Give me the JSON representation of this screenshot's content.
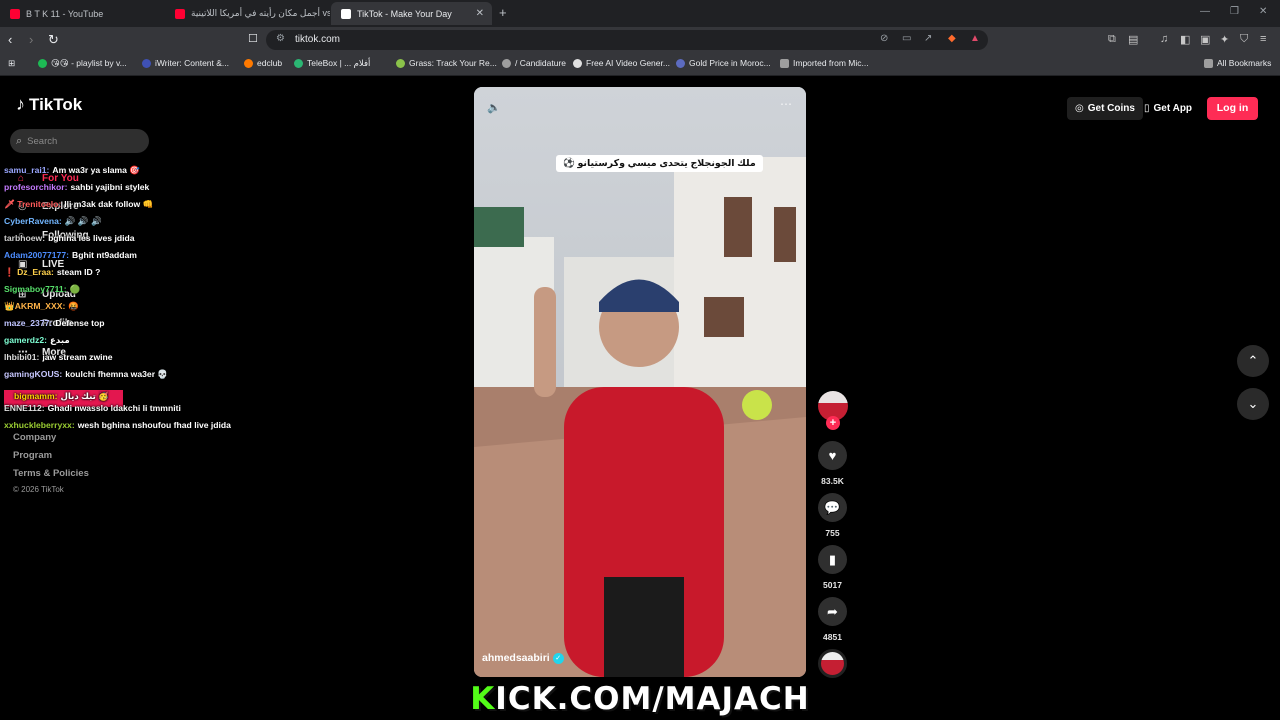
{
  "browser": {
    "tabs": [
      {
        "title": "B T K 11 - YouTube",
        "fav_color": "#ff0033"
      },
      {
        "title": "أجمل مكان رأيته في أمريكا اللاتينية vs ...",
        "fav_color": "#ff0033"
      },
      {
        "title": "TikTok - Make Your Day",
        "fav_color": "#ffffff"
      }
    ],
    "url": "tiktok.com",
    "bookmarks": [
      {
        "label": "😘😘 - playlist by v...",
        "color": "#1db954"
      },
      {
        "label": "iWriter: Content &...",
        "color": "#3f51b5"
      },
      {
        "label": "edclub",
        "color": "#ff7a00"
      },
      {
        "label": "TeleBox | ... أفلام",
        "color": "#2bb673"
      },
      {
        "label": "Grass: Track Your Re...",
        "color": "#8bc34a"
      },
      {
        "label": "/ Candidature",
        "color": "#9e9e9e"
      },
      {
        "label": "Free AI Video Gener...",
        "color": "#e0e0e0"
      },
      {
        "label": "Gold Price in Moroc...",
        "color": "#5c6bc0"
      },
      {
        "label": "Imported from Mic...",
        "color": "#9e9e9e"
      }
    ],
    "all_bookmarks": "All Bookmarks"
  },
  "sidebar": {
    "logo": "TikTok",
    "search_placeholder": "Search",
    "nav": [
      {
        "label": "For You",
        "icon": "home-icon"
      },
      {
        "label": "Explore",
        "icon": "compass-icon"
      },
      {
        "label": "Following",
        "icon": "person-icon"
      },
      {
        "label": "LIVE",
        "icon": "live-icon"
      },
      {
        "label": "Upload",
        "icon": "upload-icon"
      },
      {
        "label": "Profile",
        "icon": "profile-icon"
      },
      {
        "label": "More",
        "icon": "more-icon"
      }
    ],
    "footer": [
      "Company",
      "Program",
      "Terms & Policies"
    ],
    "copyright": "© 2026 TikTok"
  },
  "chat": [
    {
      "user": "samu_rai1:",
      "text": "Am wa3r ya slama 🎯",
      "color": "#9aa7ff"
    },
    {
      "user": "profesorchikor:",
      "text": "sahbi yajibni stylek",
      "color": "#c57bff"
    },
    {
      "user": "🗡 Trenitoelo:",
      "text": "lli m3ak dak follow 👊",
      "color": "#ff5a5a"
    },
    {
      "user": "CyberRavena:",
      "text": "🔊 🔊 🔊",
      "color": "#72b6ff"
    },
    {
      "user": "tarbhoew:",
      "text": "bghina les lives jdida",
      "color": "#cfcfcf"
    },
    {
      "user": "Adam20077177:",
      "text": "Bghit nt9addam",
      "color": "#4d8dff"
    },
    {
      "user": "❗ Dz_Eraa:",
      "text": "steam ID ?",
      "color": "#ffd24d"
    },
    {
      "user": "Sigmaboy7711:",
      "text": "🟢",
      "color": "#58e06b"
    },
    {
      "user": "👑AKRM_XXX:",
      "text": "🤬",
      "color": "#ffb347"
    },
    {
      "user": "maze_2377:",
      "text": "Defense top",
      "color": "#bfc4ff"
    },
    {
      "user": "gamerdz2:",
      "text": "مبدع",
      "color": "#7fffd4"
    },
    {
      "user": "lhbibi01:",
      "text": "jaw stream zwine",
      "color": "#dddddd"
    },
    {
      "user": "gamingKOUS:",
      "text": "koulchi fhemna wa3er 💀",
      "color": "#c7c7ff"
    },
    {
      "user": "bigmamm:",
      "text": "تبك ديال 🥳",
      "color": "#ffd400",
      "highlight": true
    },
    {
      "user": "ENNE112:",
      "text": "Ghadi nwasslo ldakchi li tmmniti",
      "color": "#e0e0e0"
    },
    {
      "user": "xxhuckleberryxx:",
      "text": "wesh bghina nshoufou fhad live jdida",
      "color": "#9acd32"
    }
  ],
  "video": {
    "caption": "ملك الجونجلاج يتحدى ميسي وكرستيانو ⚽",
    "author": "ahmedsaabiri",
    "likes": "83.5K",
    "comments": "755",
    "saves": "5017",
    "shares": "4851"
  },
  "header_right": {
    "get_coins": "Get Coins",
    "get_app": "Get App",
    "login": "Log in"
  },
  "stream_banner": {
    "k": "K",
    "rest": "ICK.COM/MAJACH"
  }
}
